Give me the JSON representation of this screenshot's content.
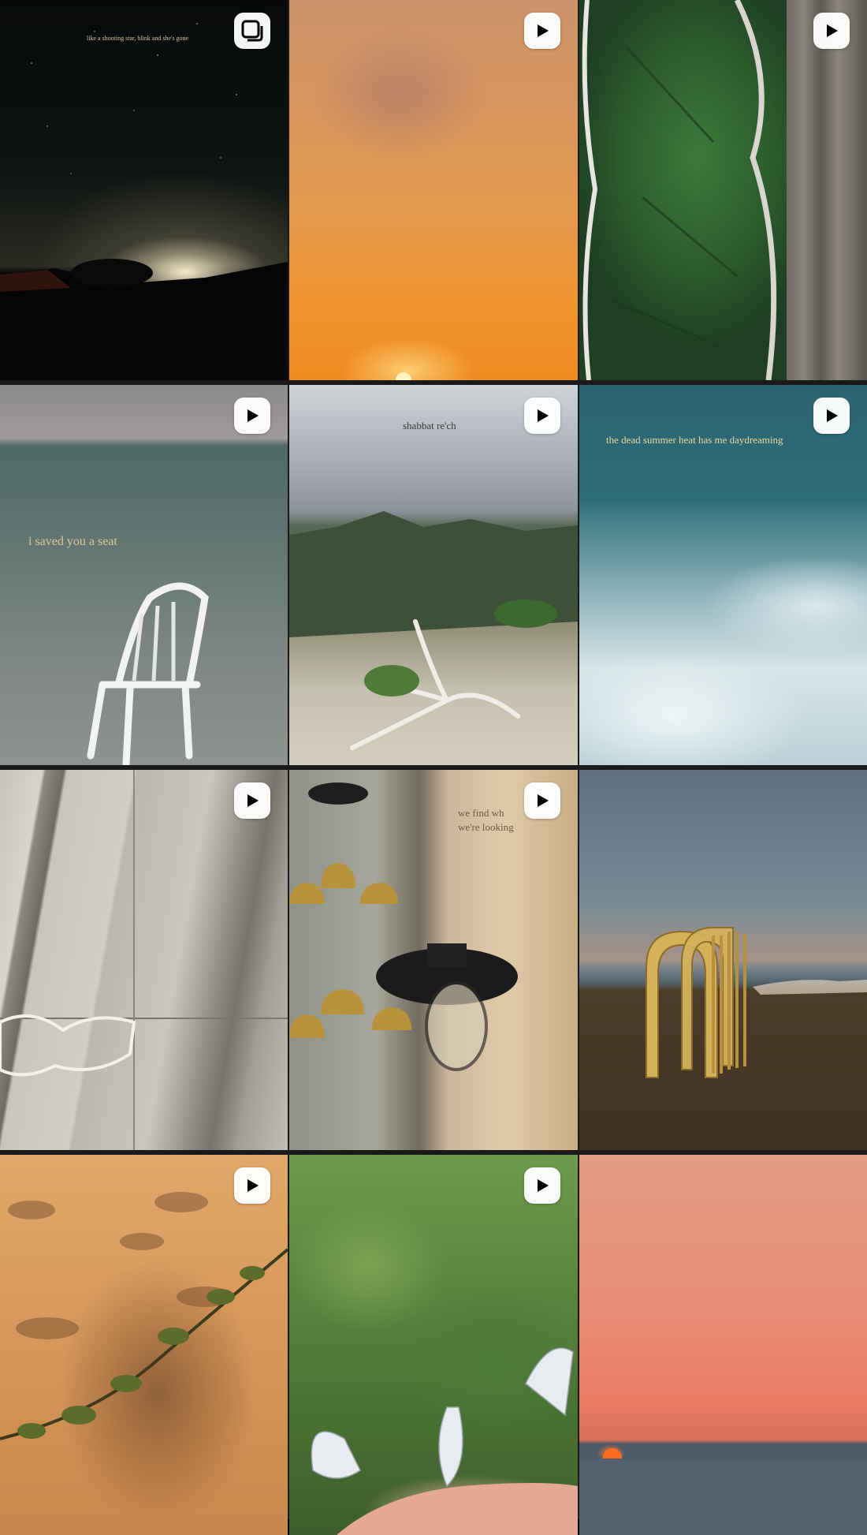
{
  "tiles": [
    {
      "type": "carousel",
      "caption": "like a shooting star, blink and she's gone"
    },
    {
      "type": "reel",
      "caption": ""
    },
    {
      "type": "reel",
      "caption": ""
    },
    {
      "type": "reel",
      "caption": "i saved you a seat"
    },
    {
      "type": "reel",
      "caption": "shabbat re'ch"
    },
    {
      "type": "reel",
      "caption": "the dead summer heat has me daydreaming"
    },
    {
      "type": "reel",
      "caption": ""
    },
    {
      "type": "reel",
      "caption": "we find wh we're looking"
    },
    {
      "type": "photo",
      "caption": ""
    },
    {
      "type": "reel",
      "caption": ""
    },
    {
      "type": "reel",
      "caption": ""
    },
    {
      "type": "photo",
      "caption": ""
    }
  ],
  "icons": {
    "reel": "play-icon",
    "carousel": "multiple-posts-icon"
  },
  "colors": {
    "badge_bg": "#ffffff",
    "caption_text": "#d9c79a",
    "grid_gap": "#1a1a1a"
  }
}
